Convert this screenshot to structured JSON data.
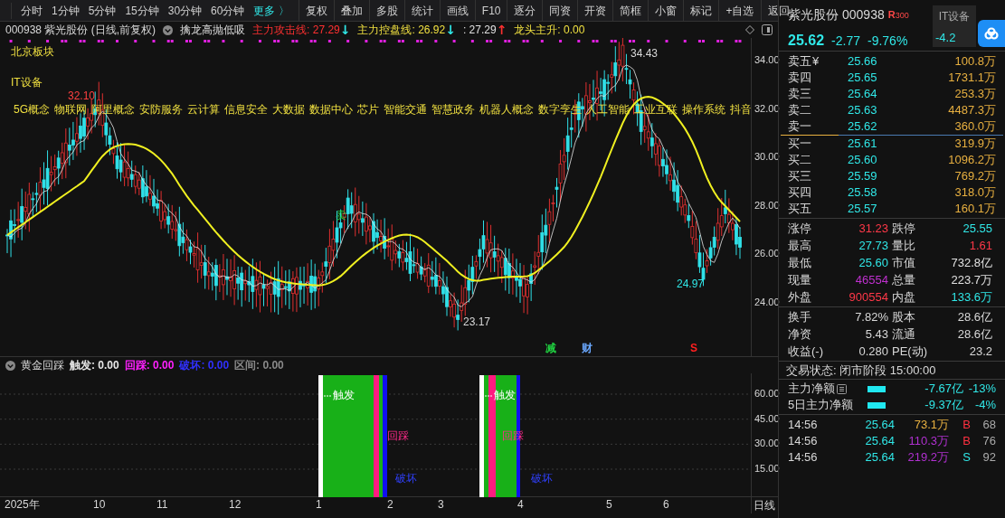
{
  "toolbar": {
    "periods": [
      "分时",
      "1分钟",
      "5分钟",
      "15分钟",
      "30分钟",
      "60分钟"
    ],
    "more": "更多 〉",
    "actions": [
      "复权",
      "叠加",
      "多股",
      "统计",
      "画线",
      "F10",
      "逐分",
      "同资",
      "开资",
      "简框",
      "小窗",
      "标记",
      "+自选",
      "返回"
    ]
  },
  "info_line": {
    "security": "000938 紫光股份 (日线,前复权)",
    "formula": "擒龙高抛低吸",
    "readings": [
      {
        "label": "主力攻击线: 27.29",
        "color": "#ff3030",
        "arrow": {
          "text": "↓",
          "color": "#30e8e8"
        }
      },
      {
        "label": "主力控盘线: 26.92",
        "color": "#f0e040",
        "arrow": {
          "text": "↓",
          "color": "#30e8e8"
        }
      },
      {
        "label": ": 27.29",
        "color": "#e0e0e0",
        "arrow": {
          "text": "↑",
          "color": "#ff3030"
        }
      },
      {
        "label": "龙头主升: 0.00",
        "color": "#f0e040"
      }
    ]
  },
  "price_chart": {
    "sector_labels": [
      "北京板块",
      "IT设备"
    ],
    "concepts": [
      "5G概念",
      "物联网",
      "阿里概念",
      "安防服务",
      "云计算",
      "信息安全",
      "大数据",
      "数据中心",
      "芯片",
      "智能交通",
      "智慧政务",
      "机器人概念",
      "数字孪生",
      "人工智能",
      "工业互联",
      "操作系统",
      "抖音"
    ],
    "price_axis": [
      "34.00",
      "32.00",
      "30.00",
      "28.00",
      "26.00",
      "24.00"
    ],
    "annotations": [
      {
        "text": "34.43",
        "kind": "high"
      },
      {
        "text": "32.10",
        "kind": "peak"
      },
      {
        "text": "23.17",
        "kind": "low"
      },
      {
        "text": "24.97",
        "kind": "recent_low"
      },
      {
        "text": "卖",
        "kind": "sell"
      },
      {
        "text": "减",
        "kind": "reduce"
      },
      {
        "text": "财",
        "kind": "finance"
      },
      {
        "text": "S",
        "kind": "s_mark"
      }
    ]
  },
  "indicator": {
    "title": "黄金回踩",
    "readings": [
      {
        "label": "触发: 0.00",
        "color": "#e8e8e8"
      },
      {
        "label": "回踩: 0.00",
        "color": "#ff20ff"
      },
      {
        "label": "破坏: 0.00",
        "color": "#3030ff"
      },
      {
        "label": "区间: 0.00",
        "color": "#8a8a8a"
      }
    ],
    "axis": [
      "60.00",
      "45.00",
      "30.00",
      "15.00"
    ],
    "signals": [
      {
        "trigger": "触发",
        "pullback": "回踩",
        "break": "破坏"
      },
      {
        "trigger": "触发",
        "pullback": "回踩",
        "break": "破坏"
      }
    ]
  },
  "date_axis": {
    "labels": [
      "2025年",
      "10",
      "11",
      "12",
      "1",
      "2",
      "3",
      "4",
      "5",
      "6"
    ],
    "period": "日线"
  },
  "quote": {
    "name": "紫光股份",
    "code": "000938",
    "badge_letter": "R",
    "badge_number": "300",
    "sector": "IT设备",
    "sector_change": "-4.2",
    "price": "25.62",
    "change": "-2.77",
    "change_pct": "-9.76%",
    "asks": [
      {
        "label": "卖五",
        "tag": "¥",
        "price": "25.66",
        "volume": "100.8万"
      },
      {
        "label": "卖四",
        "price": "25.65",
        "volume": "1731.1万"
      },
      {
        "label": "卖三",
        "price": "25.64",
        "volume": "253.3万"
      },
      {
        "label": "卖二",
        "price": "25.63",
        "volume": "4487.3万"
      },
      {
        "label": "卖一",
        "price": "25.62",
        "volume": "360.0万"
      }
    ],
    "bids": [
      {
        "label": "买一",
        "price": "25.61",
        "volume": "319.9万"
      },
      {
        "label": "买二",
        "price": "25.60",
        "volume": "1096.2万"
      },
      {
        "label": "买三",
        "price": "25.59",
        "volume": "769.2万"
      },
      {
        "label": "买四",
        "price": "25.58",
        "volume": "318.0万"
      },
      {
        "label": "买五",
        "price": "25.57",
        "volume": "160.1万"
      }
    ],
    "stats": [
      {
        "label": "涨停",
        "value": "31.23",
        "color": "#ff3848"
      },
      {
        "label": "跌停",
        "value": "25.55",
        "color": "#30e8e8"
      },
      {
        "label": "最高",
        "value": "27.73",
        "color": "#30e8e8"
      },
      {
        "label": "量比",
        "value": "1.61",
        "color": "#ff3848"
      },
      {
        "label": "最低",
        "value": "25.60",
        "color": "#30e8e8"
      },
      {
        "label": "市值",
        "value": "732.8亿",
        "color": "#e0e0e0"
      },
      {
        "label": "现量",
        "value": "46554",
        "color": "#c030d0"
      },
      {
        "label": "总量",
        "value": "223.7万",
        "color": "#e0e0e0"
      },
      {
        "label": "外盘",
        "value": "900554",
        "color": "#ff3848"
      },
      {
        "label": "内盘",
        "value": "133.6万",
        "color": "#30e8e8"
      }
    ],
    "fundamentals": [
      {
        "label": "换手",
        "value": "7.82%"
      },
      {
        "label": "股本",
        "value": "28.6亿"
      },
      {
        "label": "净资",
        "value": "5.43"
      },
      {
        "label": "流通",
        "value": "28.6亿"
      },
      {
        "label": "收益(-)",
        "value": "0.280"
      },
      {
        "label": "PE(动)",
        "value": "23.2"
      }
    ],
    "trade_status": "交易状态: 闭市阶段 15:00:00",
    "fund_flow": [
      {
        "label": "主力净额",
        "menu_icon": true,
        "amount": "-7.67亿",
        "pct": "-13%"
      },
      {
        "label": "5日主力净额",
        "menu_icon": false,
        "amount": "-9.37亿",
        "pct": "-4%"
      }
    ],
    "ticks": [
      {
        "time": "14:56",
        "price": "25.64",
        "volume": {
          "text": "73.1万",
          "color": "#e8b040"
        },
        "side": "B",
        "kind": "buy",
        "count": "68"
      },
      {
        "time": "14:56",
        "price": "25.64",
        "volume": {
          "text": "110.3万",
          "color": "#b030d0"
        },
        "side": "B",
        "kind": "buy",
        "count": "76"
      },
      {
        "time": "14:56",
        "price": "25.64",
        "volume": {
          "text": "219.2万",
          "color": "#b030d0"
        },
        "side": "S",
        "kind": "sell",
        "count": "92"
      }
    ]
  }
}
